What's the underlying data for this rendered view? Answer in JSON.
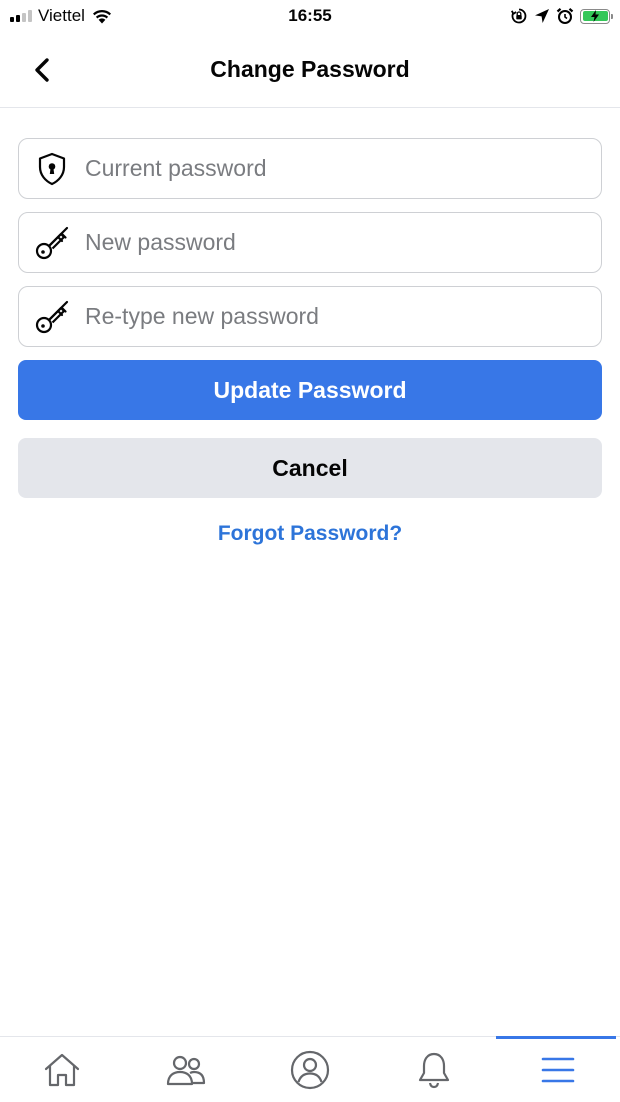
{
  "status_bar": {
    "carrier": "Viettel",
    "time": "16:55",
    "icons": [
      "signal-icon",
      "wifi-icon",
      "orientation-lock-icon",
      "location-icon",
      "alarm-icon",
      "battery-charging-icon"
    ]
  },
  "header": {
    "title": "Change Password",
    "back_icon": "chevron-left-icon"
  },
  "form": {
    "current_password": {
      "value": "",
      "placeholder": "Current password",
      "icon": "shield-keyhole-icon"
    },
    "new_password": {
      "value": "",
      "placeholder": "New password",
      "icon": "key-icon"
    },
    "retype_password": {
      "value": "",
      "placeholder": "Re-type new password",
      "icon": "key-icon"
    },
    "update_label": "Update Password",
    "cancel_label": "Cancel",
    "forgot_label": "Forgot Password?"
  },
  "bottom_nav": {
    "items": [
      {
        "icon": "home-icon",
        "active": false
      },
      {
        "icon": "friends-icon",
        "active": false
      },
      {
        "icon": "profile-icon",
        "active": false
      },
      {
        "icon": "bell-icon",
        "active": false
      },
      {
        "icon": "menu-icon",
        "active": true
      }
    ]
  },
  "colors": {
    "accent": "#3877e7",
    "link": "#2d74d9",
    "secondary_button": "#e4e6eb",
    "border": "#ced0d4",
    "battery": "#34c759"
  }
}
